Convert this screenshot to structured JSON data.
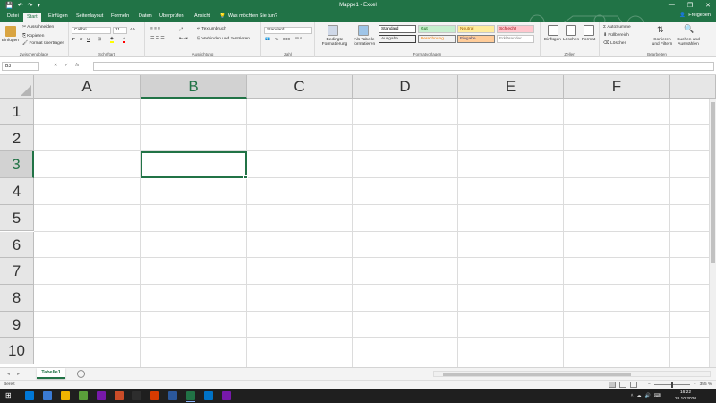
{
  "window": {
    "title": "Mappe1 - Excel",
    "qat": [
      "💾",
      "↶",
      "↷",
      "▾"
    ],
    "controls": [
      "—",
      "❐",
      "✕"
    ]
  },
  "tabs": [
    "Datei",
    "Start",
    "Einfügen",
    "Seitenlayout",
    "Formeln",
    "Daten",
    "Überprüfen",
    "Ansicht"
  ],
  "active_tab": "Start",
  "tell_me": "Was möchten Sie tun?",
  "share": "Freigeben",
  "ribbon": {
    "clipboard": {
      "paste": "Einfügen",
      "cut": "Ausschneiden",
      "copy": "Kopieren",
      "format_painter": "Format übertragen",
      "label": "Zwischenablage"
    },
    "font": {
      "name": "Calibri",
      "size": "11",
      "bold": "F",
      "italic": "K",
      "underline": "U",
      "label": "Schriftart"
    },
    "alignment": {
      "wrap": "Textumbruch",
      "merge": "Verbinden und zentrieren",
      "label": "Ausrichtung"
    },
    "number": {
      "format": "Standard",
      "percent": "%",
      "thousands": "000",
      "label": "Zahl"
    },
    "styles": {
      "conditional": "Bedingte Formatierung",
      "as_table": "Als Tabelle formatieren",
      "label": "Formatvorlagen",
      "cells": [
        {
          "label": "Standard",
          "bg": "#ffffff",
          "fg": "#000000",
          "border": "#666666"
        },
        {
          "label": "Gut",
          "bg": "#c6efce",
          "fg": "#006100",
          "border": "#c6c6c6"
        },
        {
          "label": "Neutral",
          "bg": "#ffeb9c",
          "fg": "#9c5700",
          "border": "#c6c6c6"
        },
        {
          "label": "Schlecht",
          "bg": "#ffc7ce",
          "fg": "#9c0006",
          "border": "#c6c6c6"
        },
        {
          "label": "Ausgabe",
          "bg": "#f2f2f2",
          "fg": "#3f3f3f",
          "border": "#3f3f3f"
        },
        {
          "label": "Berechnung",
          "bg": "#f2f2f2",
          "fg": "#fa7d00",
          "border": "#7f7f7f"
        },
        {
          "label": "Eingabe",
          "bg": "#ffcc99",
          "fg": "#3f3f76",
          "border": "#7f7f7f"
        },
        {
          "label": "Erklärender ...",
          "bg": "#ffffff",
          "fg": "#7f7f7f",
          "border": "#c6c6c6"
        }
      ]
    },
    "cells": {
      "insert": "Einfügen",
      "delete": "Löschen",
      "format": "Format",
      "label": "Zellen"
    },
    "editing": {
      "autosum": "AutoSumme",
      "fill": "Füllbereich",
      "clear": "Löschen",
      "sort": "Sortieren und Filtern",
      "find": "Suchen und Auswählen",
      "label": "Bearbeiten"
    }
  },
  "formula_bar": {
    "name_box": "B3",
    "fx": "fx",
    "value": ""
  },
  "grid": {
    "columns": [
      "A",
      "B",
      "C",
      "D",
      "E",
      "F"
    ],
    "rows": [
      "1",
      "2",
      "3",
      "4",
      "5",
      "6",
      "7",
      "8",
      "9",
      "10"
    ],
    "selected_column": "B",
    "selected_row": "3"
  },
  "sheets": [
    "Tabelle1"
  ],
  "status": {
    "ready": "Bereit",
    "zoom": "355 %"
  },
  "taskbar": {
    "time": "16:22",
    "date": "26.10.2020",
    "app_colors": [
      "#0078d7",
      "#3a7bd5",
      "#f0b400",
      "#5a9e3a",
      "#7719aa",
      "#ca4c28",
      "#2d2d2d",
      "#d83b01",
      "#2b579a",
      "#217346",
      "#0072c6",
      "#7719aa"
    ]
  },
  "colors": {
    "accent": "#217346",
    "ribbon_bg": "#f3f3f3",
    "header_bg": "#e6e6e6"
  }
}
